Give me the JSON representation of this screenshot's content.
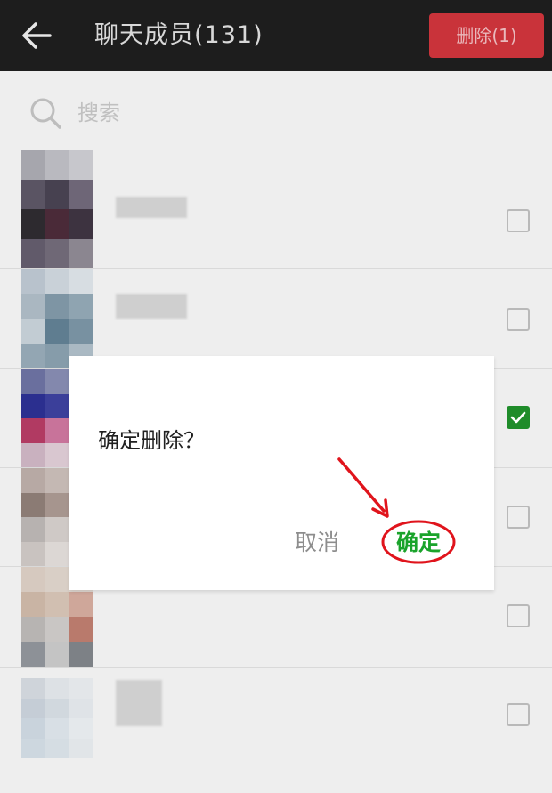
{
  "header": {
    "title": "聊天成员(131)",
    "delete_label": "删除(1)",
    "back_icon": "arrow-left-icon"
  },
  "search": {
    "placeholder": "搜索",
    "icon": "search-icon"
  },
  "members": [
    {
      "checked": false
    },
    {
      "checked": false
    },
    {
      "checked": true
    },
    {
      "checked": false
    },
    {
      "checked": false
    },
    {
      "checked": false
    }
  ],
  "dialog": {
    "message": "确定删除？",
    "cancel_label": "取消",
    "confirm_label": "确定"
  },
  "colors": {
    "topbar": "#1d1d1d",
    "delete_button": "#c9333a",
    "check_green": "#1f8c2a",
    "confirm_green": "#1aa32b",
    "annotation_red": "#e0141c"
  }
}
